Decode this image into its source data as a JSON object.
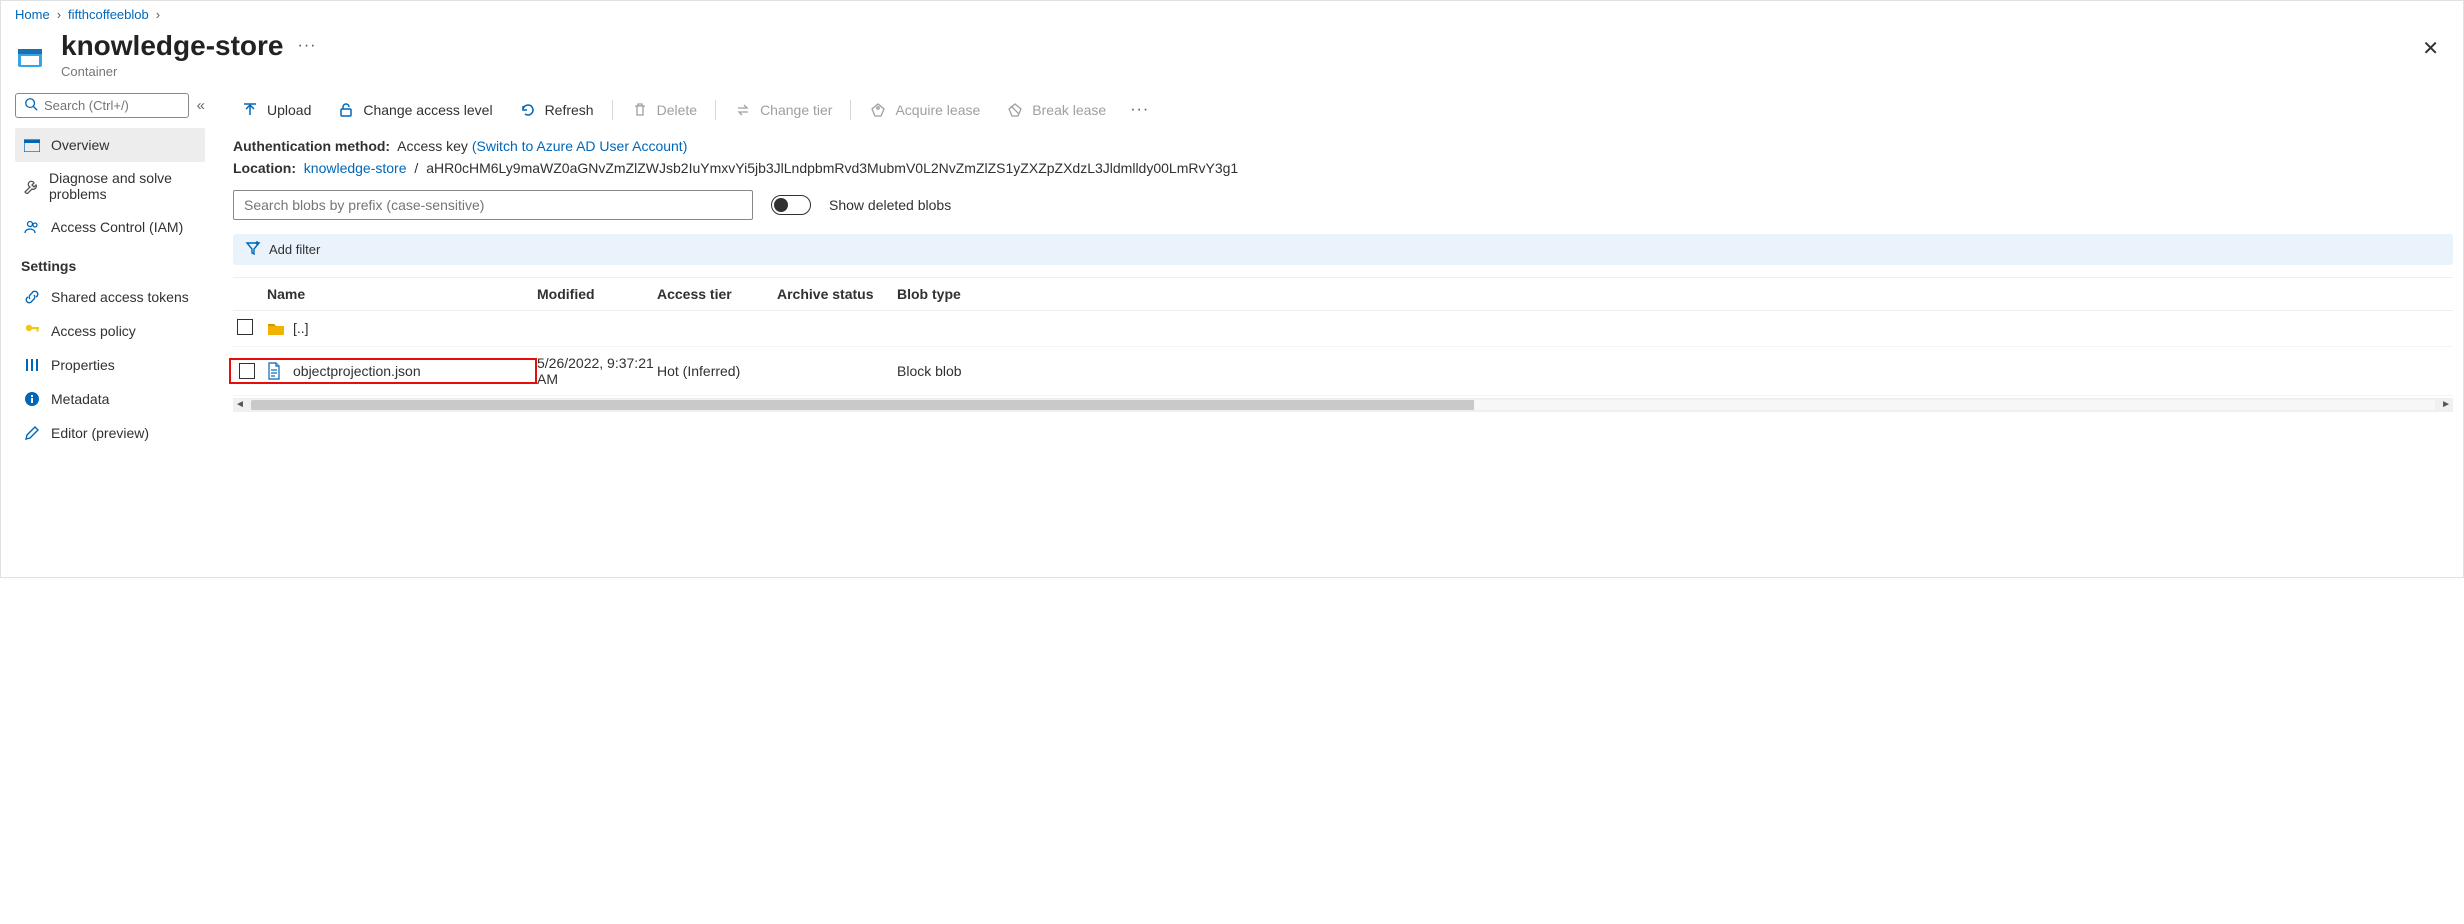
{
  "breadcrumb": {
    "home": "Home",
    "l1": "fifthcoffeeblob"
  },
  "header": {
    "title": "knowledge-store",
    "subtitle": "Container"
  },
  "sidebar": {
    "search_placeholder": "Search (Ctrl+/)",
    "items": {
      "overview": "Overview",
      "diagnose": "Diagnose and solve problems",
      "iam": "Access Control (IAM)"
    },
    "settings_label": "Settings",
    "settings": {
      "sas": "Shared access tokens",
      "policy": "Access policy",
      "properties": "Properties",
      "metadata": "Metadata",
      "editor": "Editor (preview)"
    }
  },
  "toolbar": {
    "upload": "Upload",
    "change_access": "Change access level",
    "refresh": "Refresh",
    "delete": "Delete",
    "change_tier": "Change tier",
    "acquire_lease": "Acquire lease",
    "break_lease": "Break lease"
  },
  "info": {
    "auth_label": "Authentication method:",
    "auth_value": "Access key",
    "auth_switch": "(Switch to Azure AD User Account)",
    "location_label": "Location:",
    "location_link": "knowledge-store",
    "location_sep": "/",
    "location_path": "aHR0cHM6Ly9maWZ0aGNvZmZlZWJsb2IuYmxvYi5jb3JlLndpbmRvd3MubmV0L2NvZmZlZS1yZXZpZXdzL3Jldmlldy00LmRvY3g1"
  },
  "filters": {
    "prefix_placeholder": "Search blobs by prefix (case-sensitive)",
    "show_deleted": "Show deleted blobs",
    "add_filter": "Add filter"
  },
  "table": {
    "cols": {
      "name": "Name",
      "modified": "Modified",
      "access_tier": "Access tier",
      "archive": "Archive status",
      "blob_type": "Blob type"
    },
    "up": "[..]",
    "row1": {
      "name": "objectprojection.json",
      "modified": "5/26/2022, 9:37:21 AM",
      "access_tier": "Hot (Inferred)",
      "archive": "",
      "blob_type": "Block blob"
    }
  }
}
